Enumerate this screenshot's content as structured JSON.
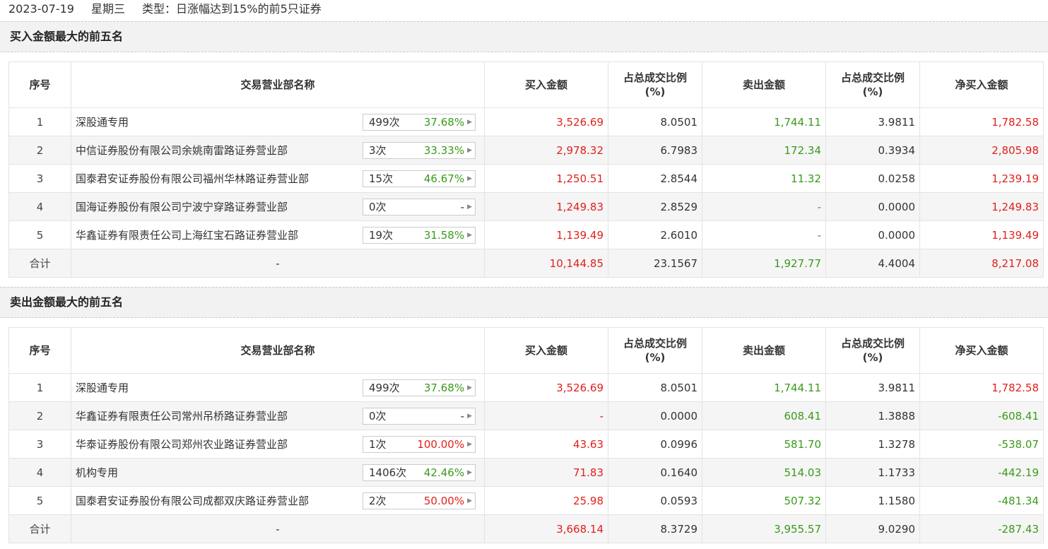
{
  "header": {
    "date": "2023-07-19",
    "weekday": "星期三",
    "type_label": "类型：日涨幅达到15%的前5只证券"
  },
  "colors": {
    "up": "#e0211c",
    "down": "#3a9a1a"
  },
  "columns": [
    "序号",
    "交易营业部名称",
    "买入金额",
    "占总成交比例\n(%)",
    "卖出金额",
    "占总成交比例\n(%)",
    "净买入金额"
  ],
  "sections": [
    {
      "title": "买入金额最大的前五名",
      "rows": [
        {
          "idx": "1",
          "name": "深股通专用",
          "count": "499次",
          "rate": "37.68%",
          "rate_color": "green",
          "buy": "3,526.69",
          "buy_pct": "8.0501",
          "sell": "1,744.11",
          "sell_pct": "3.9811",
          "net": "1,782.58",
          "net_color": "red"
        },
        {
          "idx": "2",
          "name": "中信证券股份有限公司余姚南雷路证券营业部",
          "count": "3次",
          "rate": "33.33%",
          "rate_color": "green",
          "buy": "2,978.32",
          "buy_pct": "6.7983",
          "sell": "172.34",
          "sell_pct": "0.3934",
          "net": "2,805.98",
          "net_color": "red"
        },
        {
          "idx": "3",
          "name": "国泰君安证券股份有限公司福州华林路证券营业部",
          "count": "15次",
          "rate": "46.67%",
          "rate_color": "green",
          "buy": "1,250.51",
          "buy_pct": "2.8544",
          "sell": "11.32",
          "sell_pct": "0.0258",
          "net": "1,239.19",
          "net_color": "red"
        },
        {
          "idx": "4",
          "name": "国海证券股份有限公司宁波宁穿路证券营业部",
          "count": "0次",
          "rate": "-",
          "rate_color": "black",
          "buy": "1,249.83",
          "buy_pct": "2.8529",
          "sell": "-",
          "sell_pct": "0.0000",
          "net": "1,249.83",
          "net_color": "red"
        },
        {
          "idx": "5",
          "name": "华鑫证券有限责任公司上海红宝石路证券营业部",
          "count": "19次",
          "rate": "31.58%",
          "rate_color": "green",
          "buy": "1,139.49",
          "buy_pct": "2.6010",
          "sell": "-",
          "sell_pct": "0.0000",
          "net": "1,139.49",
          "net_color": "red"
        }
      ],
      "total": {
        "label": "合计",
        "name": "-",
        "buy": "10,144.85",
        "buy_pct": "23.1567",
        "sell": "1,927.77",
        "sell_pct": "4.4004",
        "net": "8,217.08",
        "net_color": "red"
      }
    },
    {
      "title": "卖出金额最大的前五名",
      "rows": [
        {
          "idx": "1",
          "name": "深股通专用",
          "count": "499次",
          "rate": "37.68%",
          "rate_color": "green",
          "buy": "3,526.69",
          "buy_pct": "8.0501",
          "sell": "1,744.11",
          "sell_pct": "3.9811",
          "net": "1,782.58",
          "net_color": "red"
        },
        {
          "idx": "2",
          "name": "华鑫证券有限责任公司常州吊桥路证券营业部",
          "count": "0次",
          "rate": "-",
          "rate_color": "black",
          "buy": "-",
          "buy_pct": "0.0000",
          "sell": "608.41",
          "sell_pct": "1.3888",
          "net": "-608.41",
          "net_color": "green"
        },
        {
          "idx": "3",
          "name": "华泰证券股份有限公司郑州农业路证券营业部",
          "count": "1次",
          "rate": "100.00%",
          "rate_color": "red",
          "buy": "43.63",
          "buy_pct": "0.0996",
          "sell": "581.70",
          "sell_pct": "1.3278",
          "net": "-538.07",
          "net_color": "green"
        },
        {
          "idx": "4",
          "name": "机构专用",
          "count": "1406次",
          "rate": "42.46%",
          "rate_color": "green",
          "buy": "71.83",
          "buy_pct": "0.1640",
          "sell": "514.03",
          "sell_pct": "1.1733",
          "net": "-442.19",
          "net_color": "green"
        },
        {
          "idx": "5",
          "name": "国泰君安证券股份有限公司成都双庆路证券营业部",
          "count": "2次",
          "rate": "50.00%",
          "rate_color": "red",
          "buy": "25.98",
          "buy_pct": "0.0593",
          "sell": "507.32",
          "sell_pct": "1.1580",
          "net": "-481.34",
          "net_color": "green"
        }
      ],
      "total": {
        "label": "合计",
        "name": "-",
        "buy": "3,668.14",
        "buy_pct": "8.3729",
        "sell": "3,955.57",
        "sell_pct": "9.0290",
        "net": "-287.43",
        "net_color": "green"
      }
    }
  ]
}
